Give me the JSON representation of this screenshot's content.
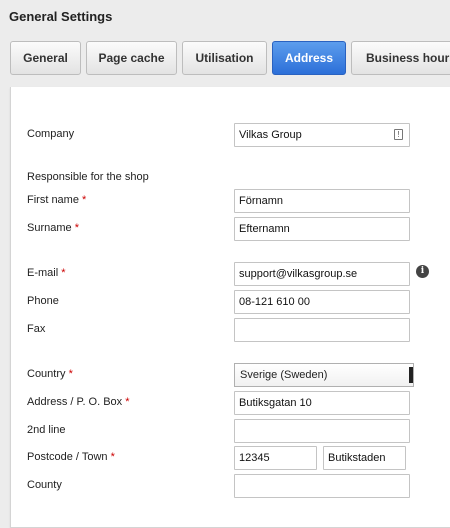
{
  "page": {
    "title": "General Settings"
  },
  "tabs": [
    {
      "label": "General"
    },
    {
      "label": "Page cache"
    },
    {
      "label": "Utilisation"
    },
    {
      "label": "Address"
    },
    {
      "label": "Business hours"
    }
  ],
  "active_tab": "Address",
  "colors": {
    "accent": "#2c6fd8",
    "required": "#cc0000"
  },
  "form": {
    "company": {
      "label": "Company",
      "value": "Vilkas Group",
      "icon": "contact-card-icon"
    },
    "responsible_heading": "Responsible for the shop",
    "first_name": {
      "label": "First name",
      "required_mark": "*",
      "value": "Förnamn"
    },
    "surname": {
      "label": "Surname",
      "required_mark": "*",
      "value": "Efternamn"
    },
    "email": {
      "label": "E-mail",
      "required_mark": "*",
      "value": "support@vilkasgroup.se",
      "info_icon": "i"
    },
    "phone": {
      "label": "Phone",
      "value": "08-121 610 00"
    },
    "fax": {
      "label": "Fax",
      "value": ""
    },
    "country": {
      "label": "Country",
      "required_mark": "*",
      "value": "Sverige (Sweden)"
    },
    "address": {
      "label": "Address / P. O. Box",
      "required_mark": "*",
      "value": "Butiksgatan 10"
    },
    "second_line": {
      "label": "2nd line",
      "value": ""
    },
    "postcode_town": {
      "label": "Postcode / Town",
      "required_mark": "*",
      "postcode": "12345",
      "town": "Butikstaden"
    },
    "county": {
      "label": "County",
      "value": ""
    }
  }
}
